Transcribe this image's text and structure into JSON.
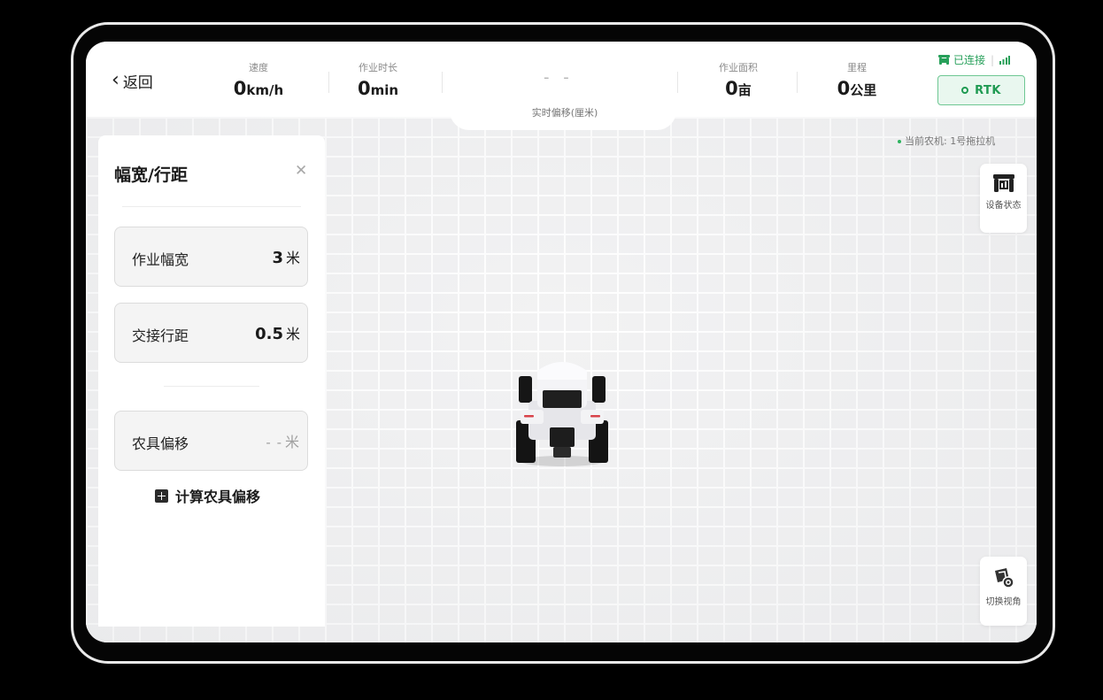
{
  "header": {
    "back_label": "返回",
    "speed": {
      "label": "速度",
      "value": "0",
      "unit": "km/h"
    },
    "duration": {
      "label": "作业时长",
      "value": "0",
      "unit": "min"
    },
    "deviation": {
      "value": "- -",
      "label": "实时偏移(厘米)"
    },
    "area": {
      "label": "作业面积",
      "value": "0",
      "unit": "亩"
    },
    "mileage": {
      "label": "里程",
      "value": "0",
      "unit": "公里"
    },
    "connection": {
      "status": "已连接",
      "separator": "|"
    },
    "rtk_label": "RTK"
  },
  "map": {
    "current_machine": "当前农机: 1号拖拉机",
    "device_status_label": "设备状态",
    "switch_view_label": "切换视角"
  },
  "panel": {
    "title": "幅宽/行距",
    "fields": [
      {
        "label": "作业幅宽",
        "value": "3",
        "unit": "米"
      },
      {
        "label": "交接行距",
        "value": "0.5",
        "unit": "米"
      },
      {
        "label": "农具偏移",
        "value": "- -",
        "unit": "米"
      }
    ],
    "calc_label": "计算农具偏移"
  },
  "colors": {
    "accent": "#27a05a",
    "rtk_bg": "#e9f7ef"
  },
  "icons": [
    "chevron-left-icon",
    "tractor-icon",
    "signal-icon",
    "close-icon",
    "calculator-icon",
    "switch-view-icon"
  ]
}
